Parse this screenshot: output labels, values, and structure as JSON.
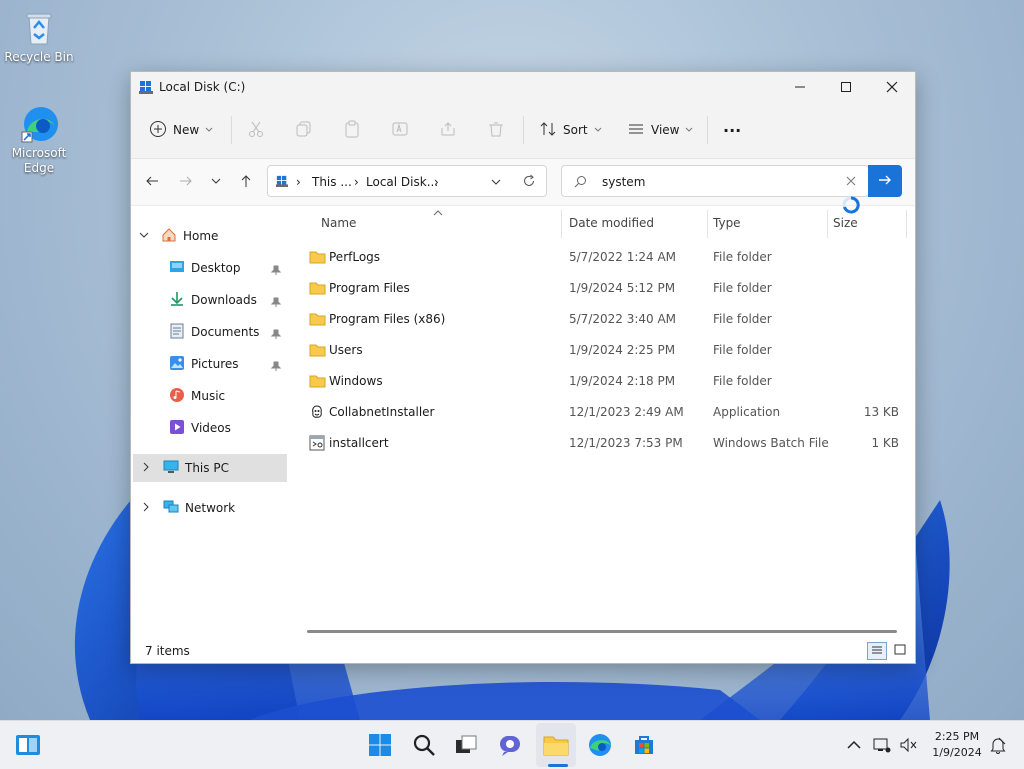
{
  "desktop": {
    "icons": [
      {
        "label": "Recycle Bin",
        "icon": "recycle-bin-icon"
      },
      {
        "label": "Microsoft Edge",
        "icon": "edge-icon"
      }
    ]
  },
  "window": {
    "title": "Local Disk (C:)",
    "toolbar": {
      "new_label": "New",
      "sort_label": "Sort",
      "view_label": "View",
      "more_label": "···"
    },
    "address": {
      "segments": [
        "This ...",
        "Local Disk..."
      ]
    },
    "search": {
      "value": "system"
    },
    "columns": {
      "name": "Name",
      "date": "Date modified",
      "type": "Type",
      "size": "Size"
    },
    "sidebar": {
      "items": [
        {
          "label": "Home",
          "icon": "home-icon"
        },
        {
          "label": "Desktop",
          "icon": "desktop-icon"
        },
        {
          "label": "Downloads",
          "icon": "download-icon"
        },
        {
          "label": "Documents",
          "icon": "document-icon"
        },
        {
          "label": "Pictures",
          "icon": "pictures-icon"
        },
        {
          "label": "Music",
          "icon": "music-icon"
        },
        {
          "label": "Videos",
          "icon": "videos-icon"
        },
        {
          "label": "This PC",
          "icon": "computer-icon"
        },
        {
          "label": "Network",
          "icon": "network-icon"
        }
      ]
    },
    "files": [
      {
        "name": "PerfLogs",
        "date": "5/7/2022 1:24 AM",
        "type": "File folder",
        "size": "",
        "icon": "folder-icon"
      },
      {
        "name": "Program Files",
        "date": "1/9/2024 5:12 PM",
        "type": "File folder",
        "size": "",
        "icon": "folder-icon"
      },
      {
        "name": "Program Files (x86)",
        "date": "5/7/2022 3:40 AM",
        "type": "File folder",
        "size": "",
        "icon": "folder-icon"
      },
      {
        "name": "Users",
        "date": "1/9/2024 2:25 PM",
        "type": "File folder",
        "size": "",
        "icon": "folder-icon"
      },
      {
        "name": "Windows",
        "date": "1/9/2024 2:18 PM",
        "type": "File folder",
        "size": "",
        "icon": "folder-icon"
      },
      {
        "name": "CollabnetInstaller",
        "date": "12/1/2023 2:49 AM",
        "type": "Application",
        "size": "13 KB",
        "icon": "application-icon"
      },
      {
        "name": "installcert",
        "date": "12/1/2023 7:53 PM",
        "type": "Windows Batch File",
        "size": "1 KB",
        "icon": "batch-file-icon"
      }
    ],
    "status": {
      "items_count": "7 items"
    }
  },
  "taskbar": {
    "time": "2:25 PM",
    "date": "1/9/2024"
  },
  "colors": {
    "accent": "#1a73d9",
    "folder": "#f8c94a",
    "selected": "#e0e0e0"
  }
}
